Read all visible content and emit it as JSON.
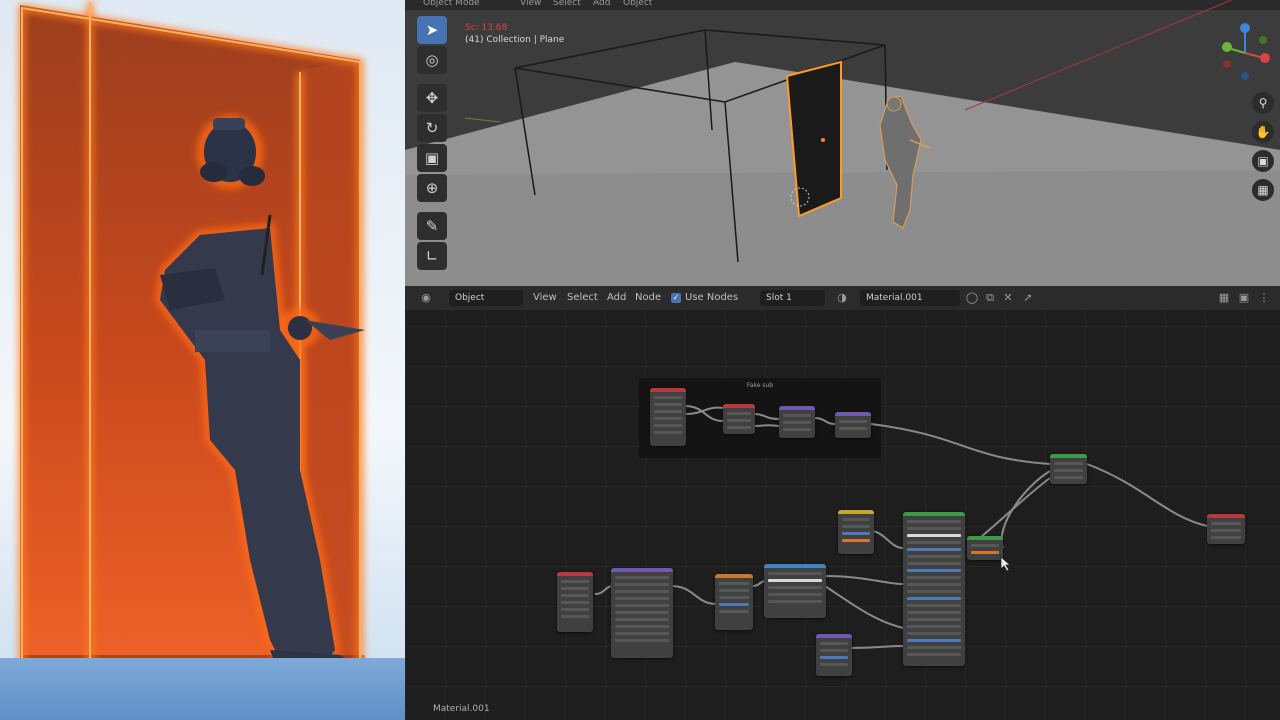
{
  "viewport": {
    "header": {
      "mode": "Object Mode",
      "menu": [
        "View",
        "Select",
        "Add",
        "Object"
      ]
    },
    "time_text": "Sc: 13.68",
    "collection_text": "(41) Collection | Plane",
    "tools": [
      "select-box-icon",
      "cursor-icon",
      "move-icon",
      "rotate-icon",
      "scale-icon",
      "transform-icon",
      "annotate-icon",
      "measure-icon"
    ],
    "nav_icons": [
      "zoom-icon",
      "pan-icon",
      "camera-view-icon",
      "perspective-icon"
    ]
  },
  "node_editor": {
    "header": {
      "editor_type_icon": "node-editor-icon",
      "object_dropdown": "Object",
      "menu": [
        "View",
        "Select",
        "Add",
        "Node"
      ],
      "use_nodes_label": "Use Nodes",
      "slot_dropdown": "Slot 1",
      "material_name": "Material.001"
    },
    "frame_label": "Fake sub",
    "status_material": "Material.001",
    "colors": {
      "node_header_red": "#b8393d",
      "node_header_purple": "#7158b5",
      "node_header_green": "#3d9a48",
      "node_header_orange": "#c77b2a",
      "node_header_blue": "#3e85c6",
      "node_header_yellow": "#c7a62e"
    }
  },
  "colors": {
    "selection_outline": "#ff7a1a",
    "active_tool": "#4772b3",
    "render_glass": "#e8581c"
  }
}
